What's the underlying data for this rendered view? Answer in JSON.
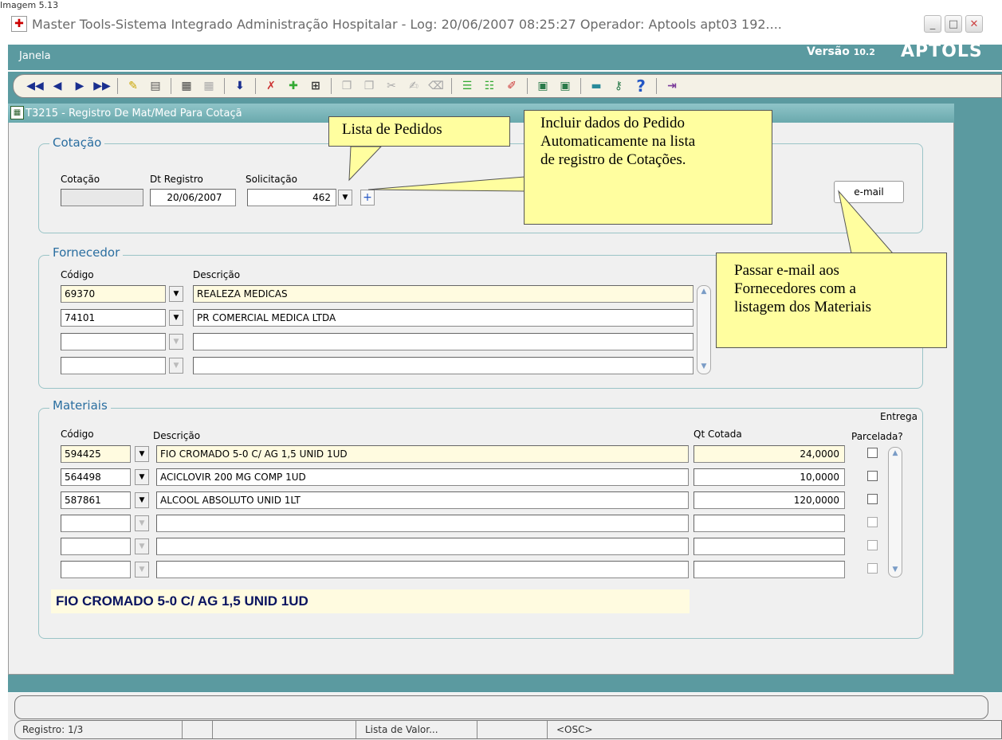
{
  "caption": "Imagem 5.13",
  "window": {
    "title": "Master Tools-Sistema Integrado Administração Hospitalar - Log: 20/06/2007 08:25:27 Operador: Aptools apt03 192....",
    "minimize": "_",
    "maximize": "□",
    "close": "✕"
  },
  "menu": {
    "janela": "Janela",
    "versao_label": "Versão",
    "versao_num": "10.2",
    "brand": "APTOLS"
  },
  "form": {
    "title": "T3215 - Registro De Mat/Med Para Cotaçã"
  },
  "cotacao": {
    "legend": "Cotação",
    "lbl_cotacao": "Cotação",
    "lbl_dt": "Dt Registro",
    "lbl_solic": "Solicitação",
    "cotacao_value": "",
    "dt_value": "20/06/2007",
    "solic_value": "462",
    "plus": "+",
    "email_button": "e-mail"
  },
  "fornecedor": {
    "legend": "Fornecedor",
    "col_codigo": "Código",
    "col_descricao": "Descrição",
    "rows": [
      {
        "codigo": "69370",
        "descricao": "REALEZA MEDICAS"
      },
      {
        "codigo": "74101",
        "descricao": "PR COMERCIAL MEDICA LTDA"
      },
      {
        "codigo": "",
        "descricao": ""
      },
      {
        "codigo": "",
        "descricao": ""
      }
    ]
  },
  "materiais": {
    "legend": "Materiais",
    "col_codigo": "Código",
    "col_descricao": "Descrição",
    "col_qt": "Qt Cotada",
    "col_entrega_1": "Entrega",
    "col_entrega_2": "Parcelada?",
    "rows": [
      {
        "codigo": "594425",
        "descricao": "FIO CROMADO 5-0 C/ AG 1,5 UNID 1UD",
        "qt": "24,0000"
      },
      {
        "codigo": "564498",
        "descricao": "ACICLOVIR 200 MG COMP 1UD",
        "qt": "10,0000"
      },
      {
        "codigo": "587861",
        "descricao": "ALCOOL ABSOLUTO UNID 1LT",
        "qt": "120,0000"
      },
      {
        "codigo": "",
        "descricao": "",
        "qt": ""
      },
      {
        "codigo": "",
        "descricao": "",
        "qt": ""
      },
      {
        "codigo": "",
        "descricao": "",
        "qt": ""
      }
    ],
    "selected_desc": "FIO CROMADO 5-0 C/ AG 1,5 UNID 1UD"
  },
  "callouts": {
    "lista": "Lista de Pedidos",
    "incluir_1": "Incluir dados do  Pedido",
    "incluir_2": "Automaticamente na lista",
    "incluir_3": "de registro de Cotações.",
    "email_1": "Passar e-mail aos",
    "email_2": "Fornecedores com a",
    "email_3": "listagem dos Materiais"
  },
  "status": {
    "registro": "Registro: 1/3",
    "lista_valor": "Lista de Valor...",
    "osc": "<OSC>"
  },
  "colors": {
    "teal": "#5b9aa0",
    "callout": "#fffe9f",
    "field_yellow": "#fffbe0",
    "legend_blue": "#2a6ea0"
  }
}
